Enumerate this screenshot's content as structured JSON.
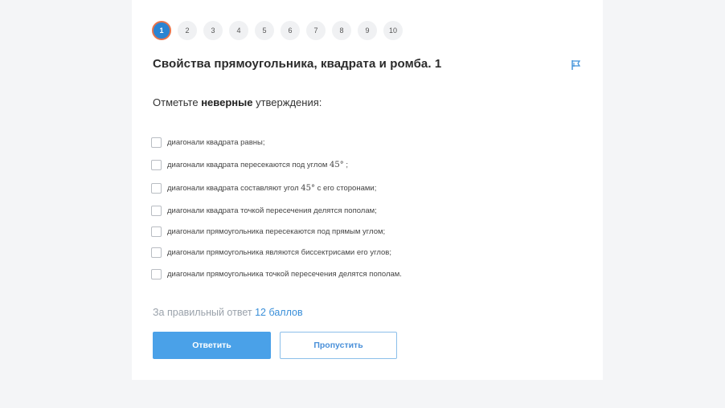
{
  "pager": {
    "pages": [
      "1",
      "2",
      "3",
      "4",
      "5",
      "6",
      "7",
      "8",
      "9",
      "10"
    ],
    "current": "1",
    "active_color": "#2a84d2",
    "active_ring_color": "#e8734a"
  },
  "question": {
    "title": "Свойства прямоугольника, квадрата и ромба. 1",
    "flag_icon": "flag-icon",
    "prompt_before": "Отметьте",
    "prompt_bold": "неверные",
    "prompt_after": "утверждения:"
  },
  "options": [
    {
      "text": "диагонали квадрата равны;",
      "math": "",
      "text_after": ""
    },
    {
      "text": "диагонали квадрата пересекаются под углом",
      "math": "45°",
      "text_after": ";"
    },
    {
      "text": "диагонали квадрата составляют угол",
      "math": "45°",
      "text_after": "с его сторонами;"
    },
    {
      "text": "диагонали квадрата точкой пересечения делятся пополам;",
      "math": "",
      "text_after": ""
    },
    {
      "text": "диагонали прямоугольника пересекаются под прямым углом;",
      "math": "",
      "text_after": ""
    },
    {
      "text": "диагонали прямоугольника являются биссектрисами его углов;",
      "math": "",
      "text_after": ""
    },
    {
      "text": "диагонали прямоугольника точкой пересечения делятся пополам.",
      "math": "",
      "text_after": ""
    }
  ],
  "score": {
    "label": "За правильный ответ",
    "points": "12 баллов"
  },
  "actions": {
    "answer_label": "Ответить",
    "skip_label": "Пропустить",
    "accent_color": "#4aa1e8"
  }
}
